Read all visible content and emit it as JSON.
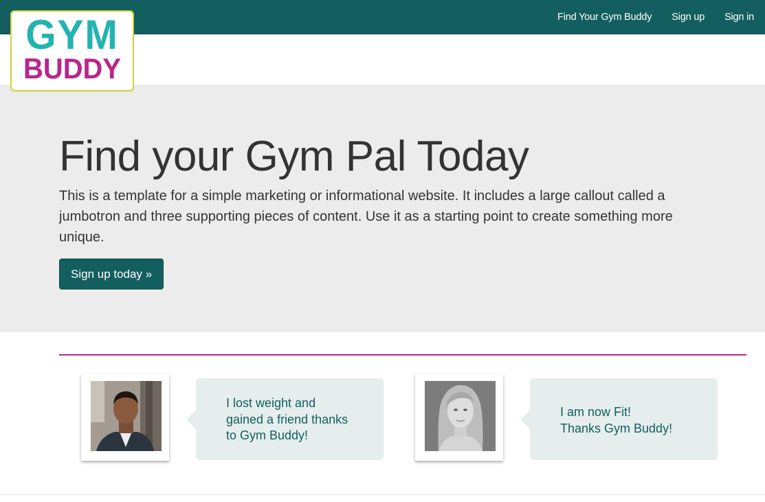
{
  "brand": {
    "logo_line1": "GYM",
    "logo_line2": "BUDDY",
    "primary_color": "#135e5f",
    "accent_teal": "#24b3b0",
    "accent_magenta": "#b8268f"
  },
  "nav": {
    "items": [
      {
        "label": "Find Your Gym Buddy"
      },
      {
        "label": "Sign up"
      },
      {
        "label": "Sign in"
      }
    ]
  },
  "jumbotron": {
    "title": "Find your Gym Pal Today",
    "text": "This is a template for a simple marketing or informational website. It includes a large callout called a jumbotron and three supporting pieces of content. Use it as a starting point to create something more unique.",
    "button_label": "Sign up today »"
  },
  "testimonials": [
    {
      "avatar": "man-portrait",
      "lines": [
        "I lost weight and",
        "gained a friend thanks",
        "to Gym Buddy!"
      ]
    },
    {
      "avatar": "woman-portrait",
      "lines": [
        "I am now Fit!",
        "Thanks Gym Buddy!"
      ]
    }
  ]
}
